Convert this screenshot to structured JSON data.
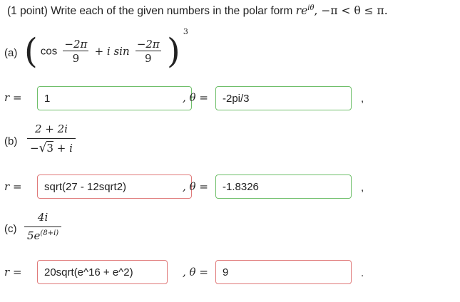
{
  "header": {
    "points": "(1 point)",
    "instruction": "Write each of the given numbers in the polar form",
    "form": "re",
    "form_exp": "iθ",
    "range": ", −π < θ ≤ π."
  },
  "labels": {
    "r_eq": "r =",
    "theta_eq": ", θ =",
    "comma": ",",
    "period": "."
  },
  "parts": [
    {
      "label": "(a)",
      "cos": "cos",
      "plus_isin": "+ i sin",
      "num1": "−2π",
      "den1": "9",
      "num2": "−2π",
      "den2": "9",
      "power": "3",
      "r_value": "1",
      "theta_value": "-2pi/3",
      "r_status": "correct",
      "theta_status": "correct"
    },
    {
      "label": "(b)",
      "numerator": "2 + 2i",
      "den_minus": "−",
      "den_radicand": "3",
      "den_rest": "+ i",
      "r_value": "sqrt(27 - 12sqrt2)",
      "theta_value": "-1.8326",
      "r_status": "incorrect",
      "theta_status": "correct"
    },
    {
      "label": "(c)",
      "numerator": "4i",
      "den_base": "5e",
      "den_exp": "(8+i)",
      "r_value": "20sqrt(e^16 + e^2)",
      "theta_value": "9",
      "r_status": "incorrect",
      "theta_status": "incorrect"
    }
  ],
  "colors": {
    "correct_border": "#6fbf6a",
    "incorrect_border": "#e07a7a"
  }
}
